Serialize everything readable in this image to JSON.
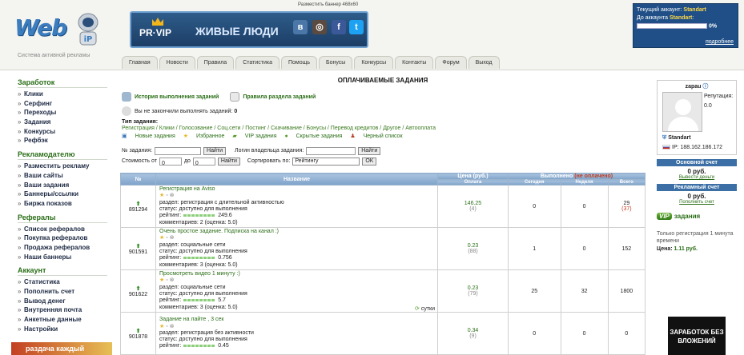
{
  "header": {
    "logo_text": "Web",
    "logo_text2": "iP",
    "logo_tagline": "Система активной рекламы",
    "banner_hint": "Разместить баннер 468x60",
    "banner_brand": "PR·VIP",
    "banner_slogan": "ЖИВЫЕ ЛЮДИ"
  },
  "nav": [
    "Главная",
    "Новости",
    "Правила",
    "Статистика",
    "Помощь",
    "Бонусы",
    "Конкурсы",
    "Контакты",
    "Форум",
    "Выход"
  ],
  "account": {
    "current_label": "Текущий аккаунт:",
    "current_value": "Standart",
    "next_label": "До аккаунта",
    "next_value": "Standart",
    "progress_text": "0%",
    "progress": 0,
    "more": "подробнее"
  },
  "sidebar": {
    "sections": [
      {
        "title": "Заработок",
        "items": [
          "Клики",
          "Серфинг",
          "Переходы",
          "Задания",
          "Конкурсы",
          "Рефбэк"
        ]
      },
      {
        "title": "Рекламодателю",
        "items": [
          "Разместить рекламу",
          "Ваши сайты",
          "Ваши задания",
          "Баннеры/ссылки",
          "Биржа показов"
        ]
      },
      {
        "title": "Рефералы",
        "items": [
          "Список рефералов",
          "Покупка рефералов",
          "Продажа рефералов",
          "Наши баннеры"
        ]
      },
      {
        "title": "Аккаунт",
        "items": [
          "Статистика",
          "Пополнить счет",
          "Вывод денег",
          "Внутренняя почта",
          "Анкетные данные",
          "Настройки"
        ]
      }
    ],
    "ad_text": "раздача каждый"
  },
  "main": {
    "title": "ОПЛАЧИВАЕМЫЕ ЗАДАНИЯ",
    "history_link": "История выполнения заданий",
    "rules_link": "Правила раздела заданий",
    "unfinished_label": "Вы не закончили выполнять заданий:",
    "unfinished_count": "0",
    "types_label": "Тип задания:",
    "types_line": "Регистрация / Клики / Голосование / Соц.сети / Постинг / Скачивание / Бонусы / Перевод кредитов / Другое / Автооплата",
    "filters2": [
      "Новые задания",
      "Избранное",
      "VIP задания",
      "Скрытые задания",
      "Черный список"
    ],
    "f_num": "№ задания:",
    "f_owner": "Логин владельца задания:",
    "f_go": "Найти",
    "f_cost": "Стоимость от",
    "f_from": "0",
    "f_to_label": "до",
    "f_to": "0",
    "f_sort": "Сортировать по:",
    "f_sort_value": "Рейтингу",
    "f_ok": "OK"
  },
  "table": {
    "h_num": "№",
    "h_name": "Название",
    "h_price": "Цена (руб.)",
    "h_done": "Выполнено",
    "h_done_extra": "(не оплачено)",
    "h_paid": "Оплата",
    "h_today": "Сегодня",
    "h_week": "Неделя",
    "h_total": "Всего",
    "rows": [
      {
        "id": "891294",
        "title": "Регистрация на Aviso",
        "section": "раздел: регистрация с длительной активностью",
        "status": "статус: доступно для выполнения",
        "rating_label": "рейтинг:",
        "rating": "249.6",
        "comments": "комментариев: 2 (оценка: 5.0)",
        "price": "146.25",
        "count": "(4)",
        "today": "0",
        "week": "0",
        "total": "29",
        "total_extra": "(37)"
      },
      {
        "id": "901591",
        "title": "Очень простое задание. Подписка на канал :)",
        "section": "раздел: социальные сети",
        "status": "статус: доступно для выполнения",
        "rating_label": "рейтинг:",
        "rating": "0.756",
        "comments": "комментариев: 3 (оценка: 5.0)",
        "price": "0.23",
        "count": "(88)",
        "today": "1",
        "week": "0",
        "total": "152",
        "total_extra": ""
      },
      {
        "id": "901622",
        "title": "Просмотреть видео 1 минуту :)",
        "section": "раздел: социальные сети",
        "status": "статус: доступно для выполнения",
        "rating_label": "рейтинг:",
        "rating": "5.7",
        "comments": "комментариев: 3 (оценка: 5.0)",
        "price": "0.23",
        "count": "(79)",
        "today": "25",
        "week": "32",
        "total": "1800",
        "total_extra": ""
      },
      {
        "id": "901878",
        "title": "Задание на лайте , 3 сек",
        "section": "раздел: регистрация без активности",
        "status": "статус: доступно для выполнения",
        "rating_label": "рейтинг:",
        "rating": "0.45",
        "comments": "",
        "price": "0.34",
        "count": "(9)",
        "today": "0",
        "week": "0",
        "total": "0",
        "total_extra": ""
      }
    ],
    "sutki": "сутки"
  },
  "user": {
    "name": "zapau",
    "rep_label": "Репутация:",
    "rep": "0.0",
    "status": "Standart",
    "ip_label": "IP:",
    "ip": "188.162.186.172",
    "main_h": "Основной счет",
    "main_v": "0 руб.",
    "main_link": "Вывести деньги",
    "ad_h": "Рекламный счет",
    "ad_v": "0 руб.",
    "ad_link": "Пополнить счет",
    "vip_badge": "VIP",
    "vip_title": "задания",
    "vip_note": "Только регистрация 1 минута времени",
    "vip_price_label": "Цена:",
    "vip_price": "1.11 руб.",
    "ad2": "ЗАРАБОТОК БЕЗ ВЛОЖЕНИЙ"
  }
}
